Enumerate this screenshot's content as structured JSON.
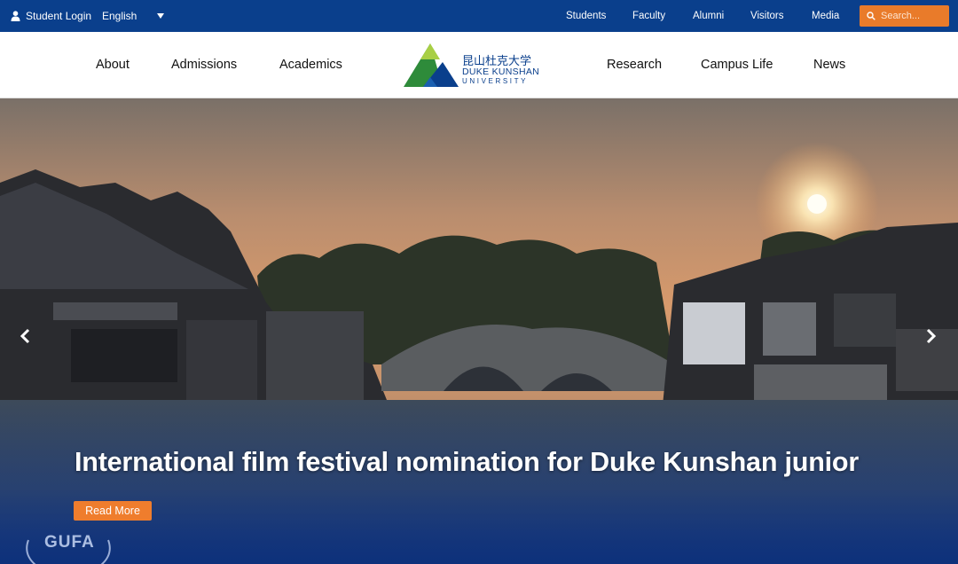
{
  "topbar": {
    "student_login": "Student Login",
    "language": "English",
    "links": [
      "Students",
      "Faculty",
      "Alumni",
      "Visitors",
      "Media"
    ],
    "search_placeholder": "Search..."
  },
  "nav": {
    "left": [
      "About",
      "Admissions",
      "Academics"
    ],
    "right": [
      "Research",
      "Campus Life",
      "News"
    ]
  },
  "logo": {
    "cn": "昆山杜克大学",
    "en_line1": "DUKE KUNSHAN",
    "en_line2": "UNIVERSITY"
  },
  "hero": {
    "headline": "International film festival nomination for Duke Kunshan junior",
    "cta": "Read More",
    "badge_text": "GUFA"
  },
  "colors": {
    "topbar": "#0a3f8c",
    "accent_orange": "#ef7d2d",
    "nav_text": "#111111"
  },
  "icons": {
    "user": "user-icon",
    "caret": "caret-down-icon",
    "search": "search-icon",
    "prev": "chevron-left-icon",
    "next": "chevron-right-icon"
  }
}
